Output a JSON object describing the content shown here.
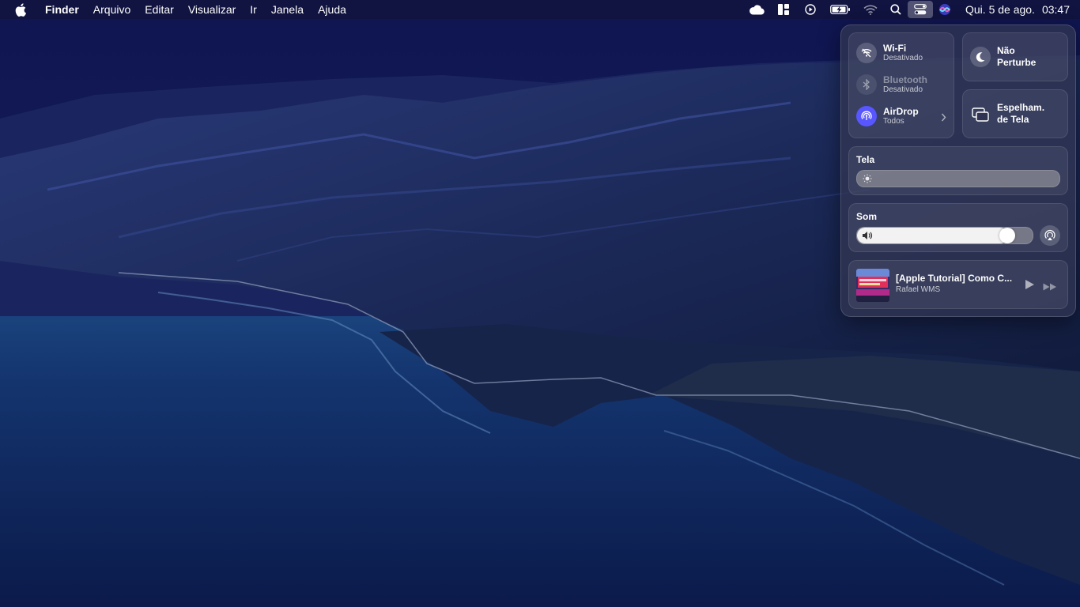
{
  "menubar": {
    "app_name": "Finder",
    "menus": [
      "Arquivo",
      "Editar",
      "Visualizar",
      "Ir",
      "Janela",
      "Ajuda"
    ],
    "status_icons": [
      "icloud-icon",
      "layout-icon",
      "play-circle-icon",
      "battery-charging-icon",
      "wifi-off-icon",
      "spotlight-search-icon",
      "control-center-icon",
      "siri-icon"
    ],
    "date": "Qui. 5 de ago.",
    "time": "03:47"
  },
  "control_center": {
    "wifi": {
      "label": "Wi-Fi",
      "status": "Desativado"
    },
    "bluetooth": {
      "label": "Bluetooth",
      "status": "Desativado"
    },
    "airdrop": {
      "label": "AirDrop",
      "status": "Todos"
    },
    "do_not_disturb": {
      "line1": "Não",
      "line2": "Perturbe"
    },
    "screen_mirroring": {
      "line1": "Espelham.",
      "line2": "de Tela"
    },
    "display": {
      "label": "Tela",
      "brightness": 0.0
    },
    "sound": {
      "label": "Som",
      "volume": 0.86
    },
    "now_playing": {
      "title": "[Apple Tutorial] Como C...",
      "artist": "Rafael WMS"
    }
  },
  "colors": {
    "airdrop_accent": "#5856ff",
    "menubar_bg": "#12143a"
  }
}
